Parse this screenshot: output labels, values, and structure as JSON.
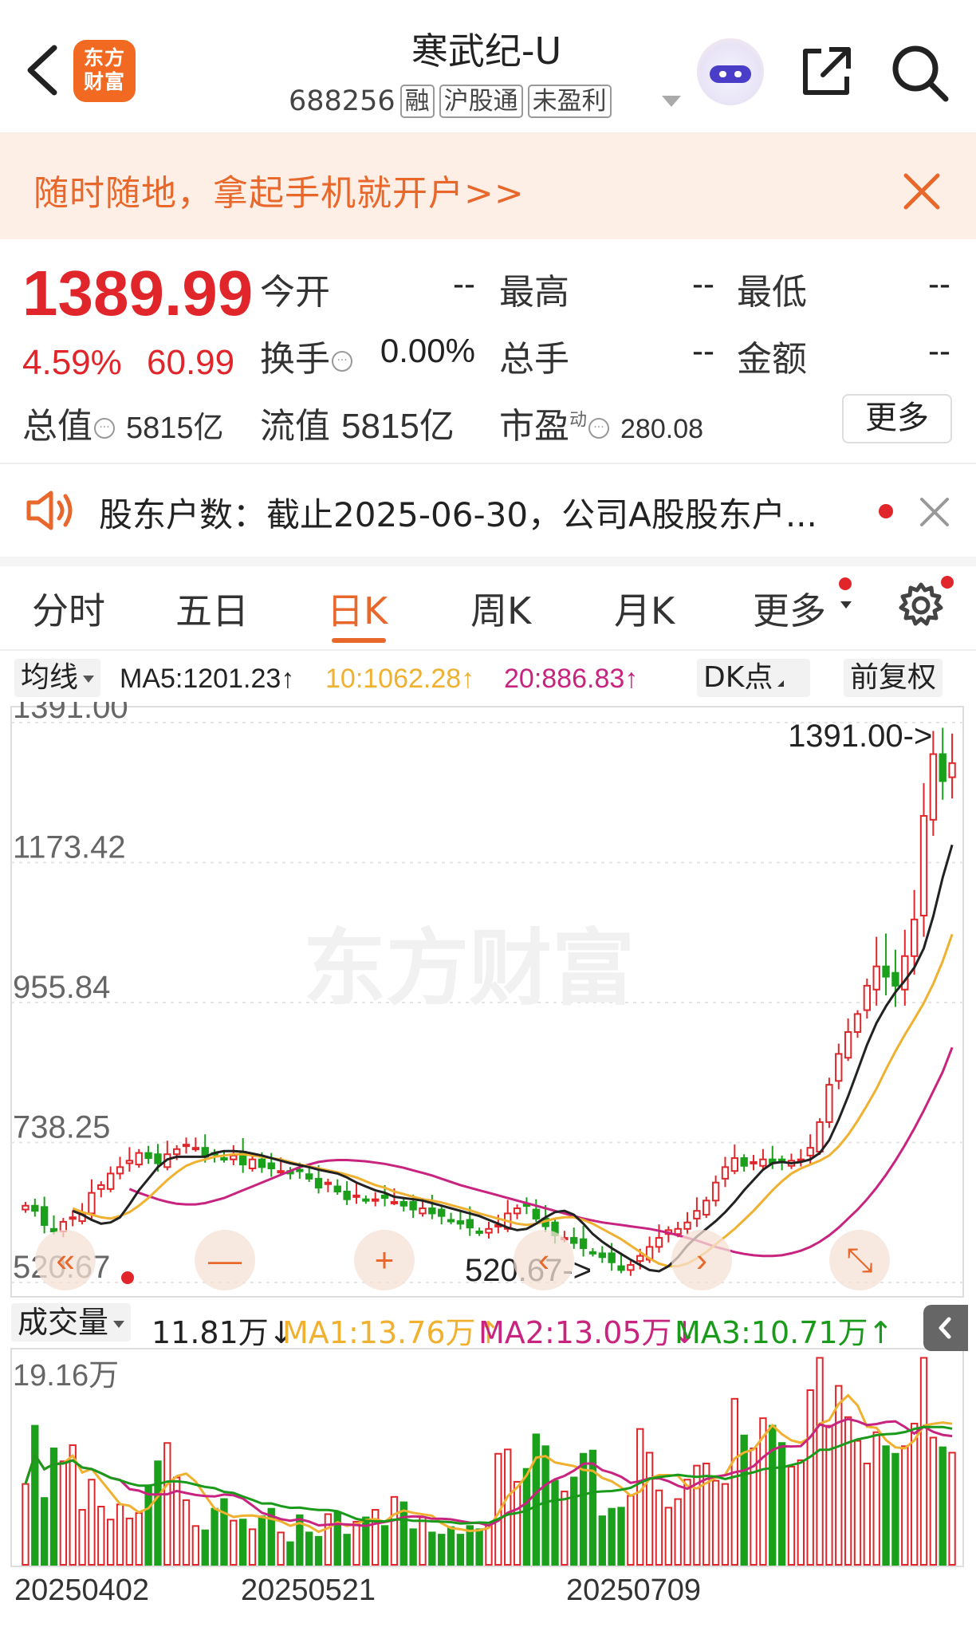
{
  "header": {
    "title": "寒武纪-U",
    "code": "688256",
    "tags": [
      "融",
      "沪股通",
      "未盈利"
    ],
    "logo_line1": "东方",
    "logo_line2": "财富"
  },
  "banner": {
    "text": "随时随地，拿起手机就开户>>"
  },
  "quote": {
    "price": "1389.99",
    "change_pct": "4.59%",
    "change_abs": "60.99",
    "fields": [
      {
        "label": "今开",
        "value": "--"
      },
      {
        "label": "最高",
        "value": "--"
      },
      {
        "label": "最低",
        "value": "--"
      },
      {
        "label": "换手",
        "value": "0.00%"
      },
      {
        "label": "总手",
        "value": "--"
      },
      {
        "label": "金额",
        "value": "--"
      }
    ],
    "total_cap_label": "总值",
    "total_cap": "5815亿",
    "float_cap_label": "流值",
    "float_cap": "5815亿",
    "pe_label": "市盈",
    "pe_sup": "动",
    "pe": "280.08",
    "more_label": "更多"
  },
  "notice": {
    "text": "股东户数：截止2025-06-30，公司A股股东户..."
  },
  "tabs": [
    "分时",
    "五日",
    "日K",
    "周K",
    "月K",
    "更多"
  ],
  "ma_bar": {
    "selector": "均线",
    "ma5": "MA5:1201.23↑",
    "ma10": "10:1062.28↑",
    "ma20": "20:886.83↑",
    "dk": "DK点",
    "adjust": "前复权"
  },
  "volume_bar": {
    "selector": "成交量",
    "current": "11.81万↓",
    "ma1": "MA1:13.76万↑",
    "ma2": "MA2:13.05万↓",
    "ma3": "MA3:10.71万↑"
  },
  "colors": {
    "up": "#e0262a",
    "down": "#1aa01a",
    "ma5": "#222222",
    "ma10": "#f0b030",
    "ma20": "#c8247f",
    "vol_ma3": "#1a9a1a",
    "accent": "#e8672a"
  },
  "chart_data": {
    "type": "candlestick",
    "price_axis_ticks": [
      "1391.00",
      "1173.42",
      "955.84",
      "738.25",
      "520.67"
    ],
    "price_range": [
      520.67,
      1391.0
    ],
    "high_label": "1391.00->",
    "low_label": "520.67->",
    "volume_axis_tick": "19.16万",
    "volume_max": 19.16,
    "date_ticks": [
      "20250402",
      "20250521",
      "20250709"
    ],
    "watermark": "东方财富",
    "closes": [
      640,
      632,
      610,
      600,
      615,
      622,
      628,
      660,
      672,
      690,
      700,
      710,
      722,
      714,
      706,
      720,
      728,
      735,
      730,
      716,
      720,
      712,
      718,
      704,
      712,
      700,
      698,
      694,
      690,
      695,
      682,
      668,
      676,
      662,
      650,
      656,
      648,
      650,
      652,
      646,
      640,
      634,
      636,
      628,
      624,
      616,
      612,
      606,
      598,
      604,
      610,
      628,
      636,
      640,
      620,
      608,
      594,
      590,
      582,
      574,
      566,
      560,
      552,
      540,
      548,
      562,
      576,
      590,
      602,
      604,
      614,
      632,
      648,
      676,
      700,
      714,
      702,
      708,
      712,
      706,
      708,
      710,
      712,
      730,
      770,
      828,
      876,
      910,
      938,
      982,
      1012,
      996,
      982,
      1028,
      1085,
      1246,
      1342,
      1300,
      1328
    ],
    "volumes": [
      7.5,
      12.9,
      6.2,
      10.8,
      9.6,
      11.1,
      5.1,
      7.9,
      5.4,
      4.2,
      5.6,
      4.3,
      4.8,
      7.3,
      9.6,
      11.3,
      8.1,
      6.0,
      3.6,
      3.2,
      5.2,
      6.1,
      4.1,
      4.2,
      3.3,
      4.5,
      5.2,
      3.0,
      2.1,
      4.6,
      3.0,
      2.6,
      4.7,
      4.9,
      2.8,
      4.0,
      4.4,
      5.1,
      3.6,
      6.3,
      5.8,
      3.3,
      4.4,
      3.0,
      2.8,
      3.5,
      2.8,
      3.6,
      3.3,
      3.9,
      10.3,
      10.7,
      7.7,
      8.9,
      12.1,
      11.0,
      7.8,
      6.8,
      8.1,
      10.3,
      10.6,
      4.5,
      5.2,
      5.3,
      6.4,
      12.6,
      10.4,
      6.9,
      5.3,
      6.1,
      7.9,
      9.2,
      9.4,
      7.8,
      7.5,
      15.4,
      12.0,
      10.8,
      13.6,
      12.9,
      11.3,
      9.1,
      9.7,
      16.2,
      19.2,
      12.9,
      16.6,
      13.7,
      11.5,
      9.4,
      12.3,
      11.0,
      10.3,
      11.0,
      13.1,
      19.2,
      11.8,
      10.9,
      10.4
    ],
    "ma5": [
      632,
      626,
      618,
      612,
      614,
      622,
      642,
      664,
      682,
      700,
      712,
      716,
      716,
      716,
      716,
      722,
      725,
      725,
      724,
      721,
      718,
      714,
      710,
      706,
      703,
      700,
      696,
      693,
      690,
      684,
      676,
      670,
      664,
      660,
      654,
      652,
      650,
      648,
      644,
      640,
      636,
      632,
      628,
      624,
      618,
      612,
      606,
      602,
      604,
      612,
      622,
      630,
      632,
      626,
      612,
      596,
      584,
      574,
      565,
      556,
      548,
      540,
      538,
      546,
      560,
      578,
      592,
      604,
      616,
      630,
      646,
      664,
      680,
      696,
      706,
      708,
      706,
      708,
      712,
      722,
      742,
      774,
      810,
      850,
      890,
      924,
      950,
      972,
      990,
      1010,
      1040,
      1090,
      1150,
      1201
    ],
    "ma10": [
      636,
      630,
      626,
      622,
      620,
      624,
      630,
      640,
      652,
      666,
      680,
      692,
      702,
      708,
      712,
      716,
      718,
      720,
      720,
      718,
      716,
      714,
      712,
      708,
      704,
      701,
      698,
      695,
      692,
      688,
      684,
      678,
      672,
      668,
      662,
      658,
      654,
      650,
      648,
      645,
      641,
      637,
      633,
      628,
      624,
      620,
      616,
      612,
      610,
      612,
      616,
      620,
      622,
      622,
      618,
      612,
      604,
      596,
      588,
      578,
      568,
      558,
      550,
      546,
      546,
      550,
      558,
      568,
      580,
      592,
      604,
      618,
      632,
      648,
      664,
      678,
      690,
      698,
      704,
      710,
      718,
      732,
      750,
      772,
      796,
      822,
      852,
      880,
      906,
      930,
      955,
      985,
      1020,
      1062
    ],
    "ma20": [
      666,
      660,
      655,
      650,
      646,
      643,
      642,
      642,
      644,
      648,
      652,
      658,
      664,
      670,
      676,
      682,
      688,
      694,
      700,
      704,
      708,
      710,
      711,
      711,
      710,
      709,
      707,
      705,
      702,
      699,
      695,
      691,
      687,
      682,
      677,
      672,
      668,
      664,
      660,
      656,
      652,
      648,
      644,
      640,
      636,
      632,
      628,
      624,
      620,
      617,
      614,
      612,
      610,
      608,
      606,
      604,
      601,
      598,
      594,
      590,
      586,
      581,
      576,
      572,
      568,
      565,
      563,
      562,
      562,
      563,
      566,
      570,
      576,
      584,
      594,
      606,
      620,
      634,
      650,
      668,
      688,
      710,
      734,
      760,
      788,
      818,
      848,
      886
    ]
  }
}
